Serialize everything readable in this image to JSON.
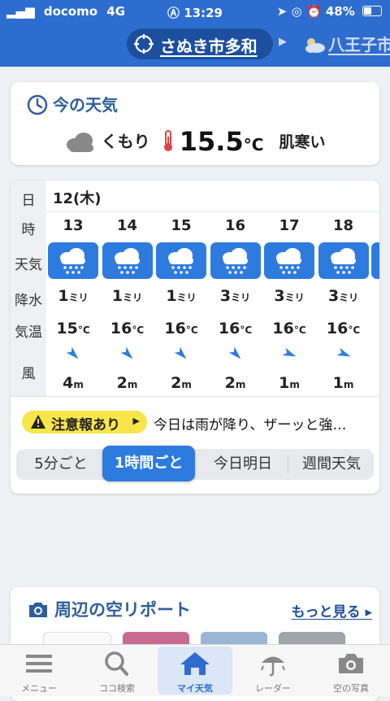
{
  "status_bar": {
    "carrier": "docomo",
    "network": "4G",
    "time": "13:29",
    "battery": "48%",
    "battery_level": 0.48
  },
  "header": {
    "location": "さぬき市多和",
    "next_location": "八王子市"
  },
  "current": {
    "title": "今の天気",
    "condition": "くもり",
    "temperature": "15.5",
    "temp_unit": "°C",
    "feeling": "肌寒い"
  },
  "forecast": {
    "row_labels": {
      "day": "日",
      "hour": "時",
      "weather": "天気",
      "precip": "降水",
      "temp": "気温",
      "wind": "風"
    },
    "day": "12(木)",
    "hours": [
      {
        "hour": "13",
        "weather_icon": "rain-cloud-icon",
        "precip": "1",
        "precip_unit": "ミリ",
        "temp": "15",
        "temp_unit": "°C",
        "wind_dir": "NW",
        "wind_speed": "4",
        "wind_unit": "m"
      },
      {
        "hour": "14",
        "weather_icon": "rain-cloud-icon",
        "precip": "1",
        "precip_unit": "ミリ",
        "temp": "16",
        "temp_unit": "°C",
        "wind_dir": "NW",
        "wind_speed": "2",
        "wind_unit": "m"
      },
      {
        "hour": "15",
        "weather_icon": "rain-cloud-icon",
        "precip": "1",
        "precip_unit": "ミリ",
        "temp": "16",
        "temp_unit": "°C",
        "wind_dir": "NW",
        "wind_speed": "2",
        "wind_unit": "m"
      },
      {
        "hour": "16",
        "weather_icon": "rain-cloud-icon",
        "precip": "3",
        "precip_unit": "ミリ",
        "temp": "16",
        "temp_unit": "°C",
        "wind_dir": "NW",
        "wind_speed": "2",
        "wind_unit": "m"
      },
      {
        "hour": "17",
        "weather_icon": "rain-cloud-icon",
        "precip": "3",
        "precip_unit": "ミリ",
        "temp": "16",
        "temp_unit": "°C",
        "wind_dir": "WNW",
        "wind_speed": "1",
        "wind_unit": "m"
      },
      {
        "hour": "18",
        "weather_icon": "rain-cloud-icon",
        "precip": "3",
        "precip_unit": "ミリ",
        "temp": "16",
        "temp_unit": "°C",
        "wind_dir": "WNW",
        "wind_speed": "1",
        "wind_unit": "m"
      }
    ],
    "alert_label": "注意報あり",
    "alert_text": "今日は雨が降り、ザーッと強…",
    "segments": [
      "5分ごと",
      "1時間ごと",
      "今日明日",
      "週間天気"
    ],
    "active_segment": "1時間ごと"
  },
  "report": {
    "title": "周辺の空リポート",
    "more": "もっと見る"
  },
  "tabbar": {
    "items": [
      {
        "label": "メニュー",
        "icon": "menu-icon"
      },
      {
        "label": "ココ検索",
        "icon": "search-icon"
      },
      {
        "label": "マイ天気",
        "icon": "home-icon"
      },
      {
        "label": "レーダー",
        "icon": "radar-umbrella-icon"
      },
      {
        "label": "空の写真",
        "icon": "camera-icon"
      }
    ],
    "active": "マイ天気"
  },
  "colors": {
    "brand_blue": "#2e6dd0",
    "weather_tile": "#2e7be0",
    "alert_yellow": "#f7e54a",
    "title_blue": "#2e5e9b"
  }
}
